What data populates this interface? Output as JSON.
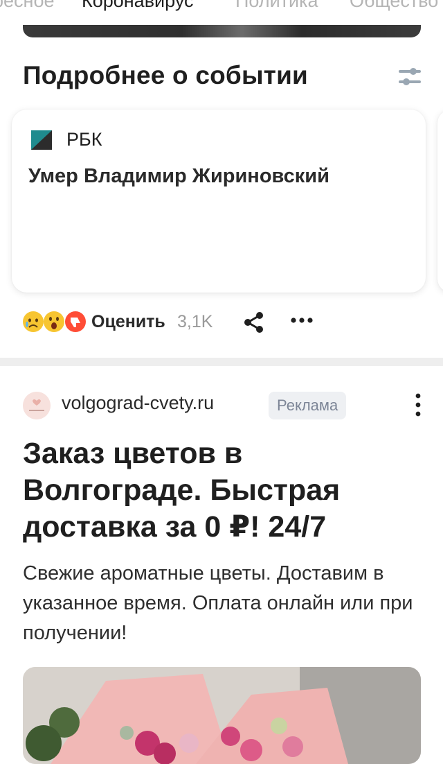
{
  "tabs": [
    {
      "label": "ресное",
      "active": false
    },
    {
      "label": "Коронавирус",
      "active": true
    },
    {
      "label": "Политика",
      "active": false
    },
    {
      "label": "Общество",
      "active": false
    }
  ],
  "story": {
    "heading": "Подробнее о событии",
    "card": {
      "source": "РБК",
      "title": "Умер Владимир Жириновский"
    },
    "reactions": {
      "rate_label": "Оценить",
      "count": "3,1K"
    }
  },
  "ad": {
    "domain": "volgograd-cvety.ru",
    "badge": "Реклама",
    "logo_text": "LA BOKET",
    "title": "Заказ цветов в Волгограде. Быстрая доставка за 0 ₽! 24/7",
    "text": "Свежие ароматные цветы. Доставим в указанное время. Оплата онлайн или при получении!"
  },
  "colors": {
    "muted": "#b5b5b5",
    "badge_bg": "#eef0f3",
    "badge_text": "#7c8596",
    "rbk_teal": "#1f8b8e"
  }
}
